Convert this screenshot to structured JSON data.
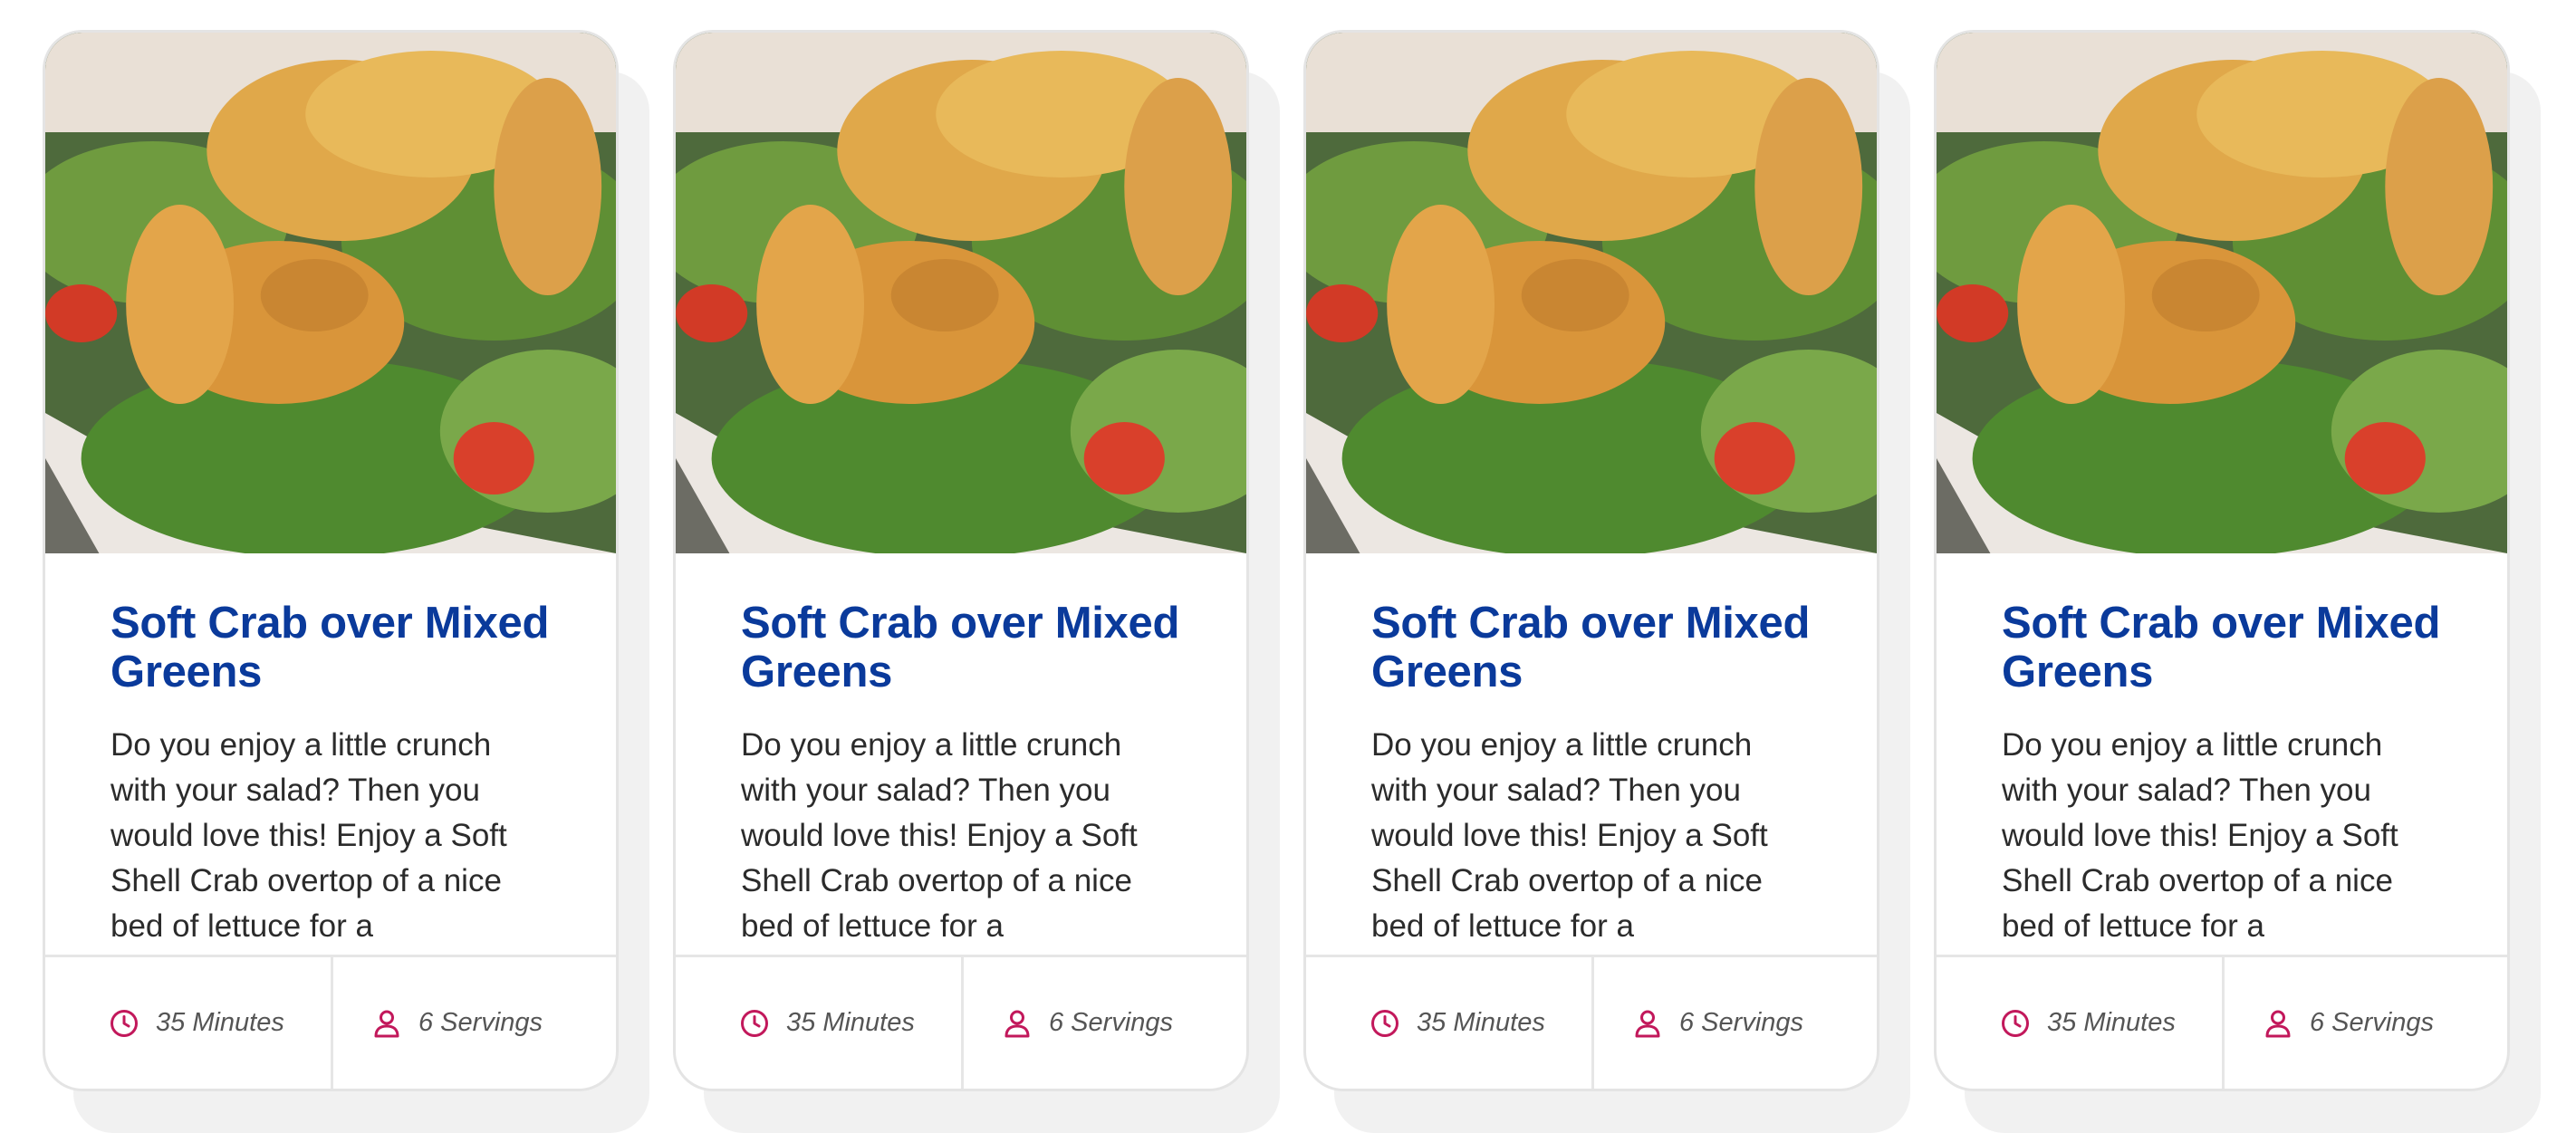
{
  "accent_colors": {
    "title": "#0a3a9b",
    "icon": "#c2185b",
    "text": "#2b2b2b",
    "meta_text": "#555555"
  },
  "cards": [
    {
      "title": "Soft Crab over Mixed Greens",
      "description": "Do you enjoy a little crunch with your salad? Then you would love this! Enjoy a Soft Shell Crab overtop of a nice bed of lettuce for a",
      "time_icon": "clock-icon",
      "time": "35 Minutes",
      "servings_icon": "person-icon",
      "servings": "6 Servings"
    },
    {
      "title": "Soft Crab over Mixed Greens",
      "description": "Do you enjoy a little crunch with your salad? Then you would love this! Enjoy a Soft Shell Crab overtop of a nice bed of lettuce for a",
      "time_icon": "clock-icon",
      "time": "35 Minutes",
      "servings_icon": "person-icon",
      "servings": "6 Servings"
    },
    {
      "title": "Soft Crab over Mixed Greens",
      "description": "Do you enjoy a little crunch with your salad? Then you would love this! Enjoy a Soft Shell Crab overtop of a nice bed of lettuce for a",
      "time_icon": "clock-icon",
      "time": "35 Minutes",
      "servings_icon": "person-icon",
      "servings": "6 Servings"
    },
    {
      "title": "Soft Crab over Mixed Greens",
      "description": "Do you enjoy a little crunch with your salad? Then you would love this! Enjoy a Soft Shell Crab overtop of a nice bed of lettuce for a",
      "time_icon": "clock-icon",
      "time": "35 Minutes",
      "servings_icon": "person-icon",
      "servings": "6 Servings"
    }
  ]
}
